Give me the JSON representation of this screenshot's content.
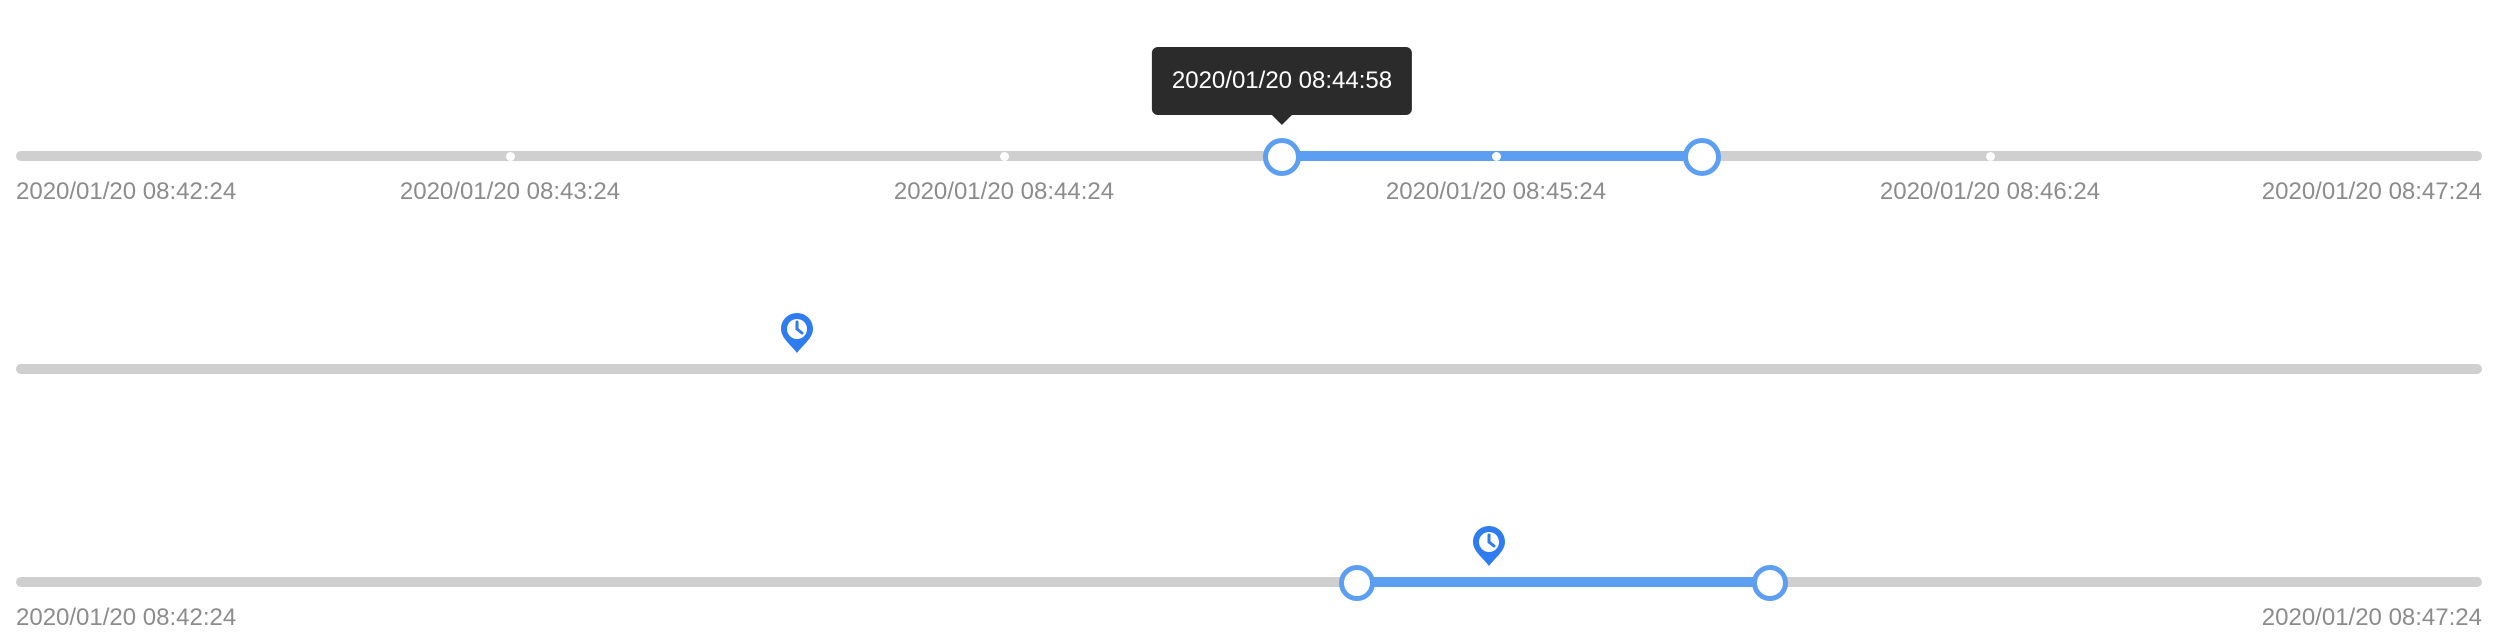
{
  "colors": {
    "accent": "#5b9ef2",
    "pin": "#2f7bf0",
    "track": "#cfcfcf",
    "tooltip_bg": "#2b2b2b",
    "label": "#8c8c8c"
  },
  "slider1": {
    "tooltip": "2020/01/20 08:44:58",
    "labels": [
      "2020/01/20 08:42:24",
      "2020/01/20 08:43:24",
      "2020/01/20 08:44:24",
      "2020/01/20 08:45:24",
      "2020/01/20 08:46:24",
      "2020/01/20 08:47:24"
    ],
    "handle_start": "2020/01/20 08:44:58",
    "handle_end": "2020/01/20 08:45:49"
  },
  "slider2": {
    "marker_icon": "clock-pin-icon",
    "marker_time": "2020/01/20 08:43:59"
  },
  "slider3": {
    "label_start": "2020/01/20 08:42:24",
    "label_end": "2020/01/20 08:47:24",
    "handle_start": "2020/01/20 08:45:07",
    "handle_end": "2020/01/20 08:45:57",
    "marker_icon": "clock-pin-icon",
    "marker_time": "2020/01/20 08:45:23"
  }
}
